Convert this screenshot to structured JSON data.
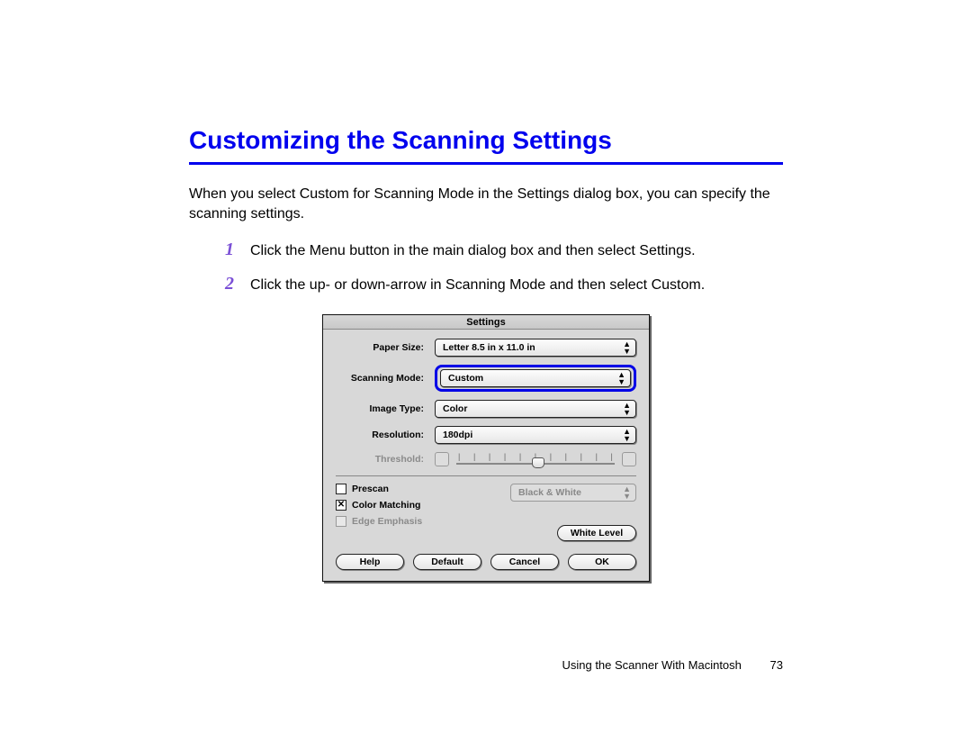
{
  "heading": "Customizing the Scanning Settings",
  "intro": "When you select Custom for Scanning Mode in the Settings dialog box, you can specify the scanning settings.",
  "steps": [
    {
      "num": "1",
      "text": "Click the Menu button in the main dialog box and then select Settings."
    },
    {
      "num": "2",
      "text": "Click the up- or down-arrow in Scanning Mode and then select Custom."
    }
  ],
  "dialog": {
    "title": "Settings",
    "paper_size": {
      "label": "Paper Size:",
      "value": "Letter 8.5 in x 11.0 in"
    },
    "scanning_mode": {
      "label": "Scanning Mode:",
      "value": "Custom"
    },
    "image_type": {
      "label": "Image Type:",
      "value": "Color"
    },
    "resolution": {
      "label": "Resolution:",
      "value": "180dpi"
    },
    "threshold_label": "Threshold:",
    "prescan": "Prescan",
    "color_matching": "Color Matching",
    "edge_emphasis": "Edge Emphasis",
    "bw_dropdown": "Black & White",
    "white_level": "White Level",
    "buttons": {
      "help": "Help",
      "default": "Default",
      "cancel": "Cancel",
      "ok": "OK"
    }
  },
  "footer": {
    "section": "Using the Scanner With Macintosh",
    "page": "73"
  }
}
